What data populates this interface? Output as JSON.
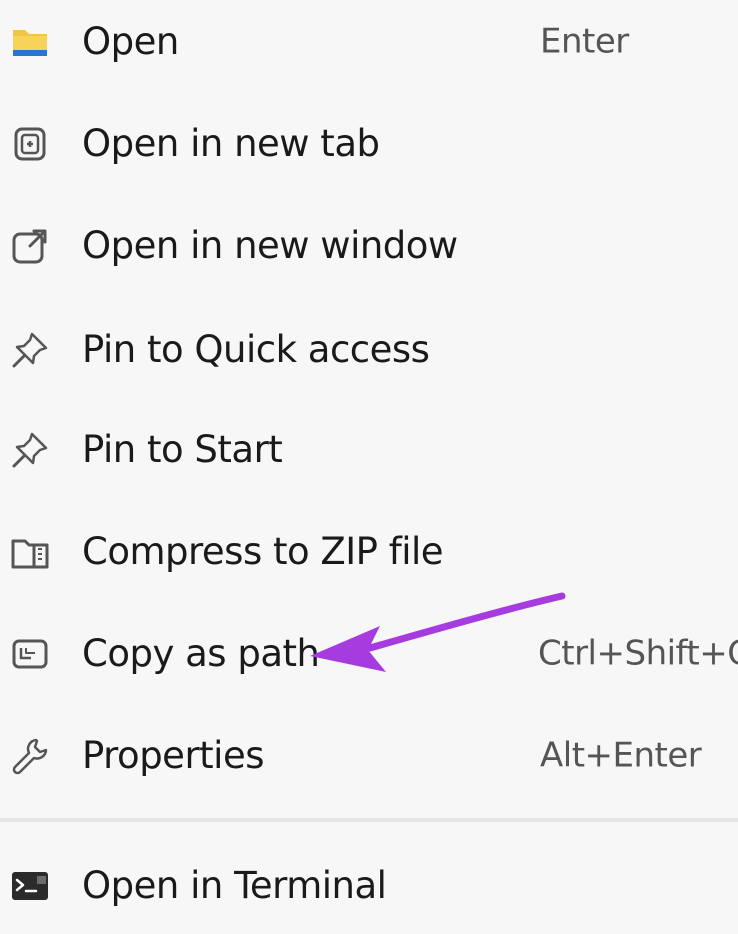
{
  "context_menu": {
    "items": [
      {
        "label": "Open",
        "shortcut": "Enter",
        "icon": "folder-icon"
      },
      {
        "label": "Open in new tab",
        "shortcut": "",
        "icon": "new-tab-icon"
      },
      {
        "label": "Open in new window",
        "shortcut": "",
        "icon": "new-window-icon"
      },
      {
        "label": "Pin to Quick access",
        "shortcut": "",
        "icon": "pin-icon"
      },
      {
        "label": "Pin to Start",
        "shortcut": "",
        "icon": "pin-icon"
      },
      {
        "label": "Compress to ZIP file",
        "shortcut": "",
        "icon": "zip-folder-icon"
      },
      {
        "label": "Copy as path",
        "shortcut": "Ctrl+Shift+C",
        "icon": "copy-path-icon"
      },
      {
        "label": "Properties",
        "shortcut": "Alt+Enter",
        "icon": "wrench-icon"
      },
      {
        "label": "Open in Terminal",
        "shortcut": "",
        "icon": "terminal-icon"
      }
    ]
  },
  "annotation": {
    "arrow_icon": "arrow-icon",
    "arrow_target": "Copy as path",
    "arrow_color": "#a63be0"
  },
  "colors": {
    "background": "#f7f7f7",
    "text": "#1a1a1a",
    "shortcut_text": "#555555",
    "divider": "#e6e6e6",
    "folder_yellow": "#f4c542",
    "folder_blue": "#2e6fd8"
  }
}
